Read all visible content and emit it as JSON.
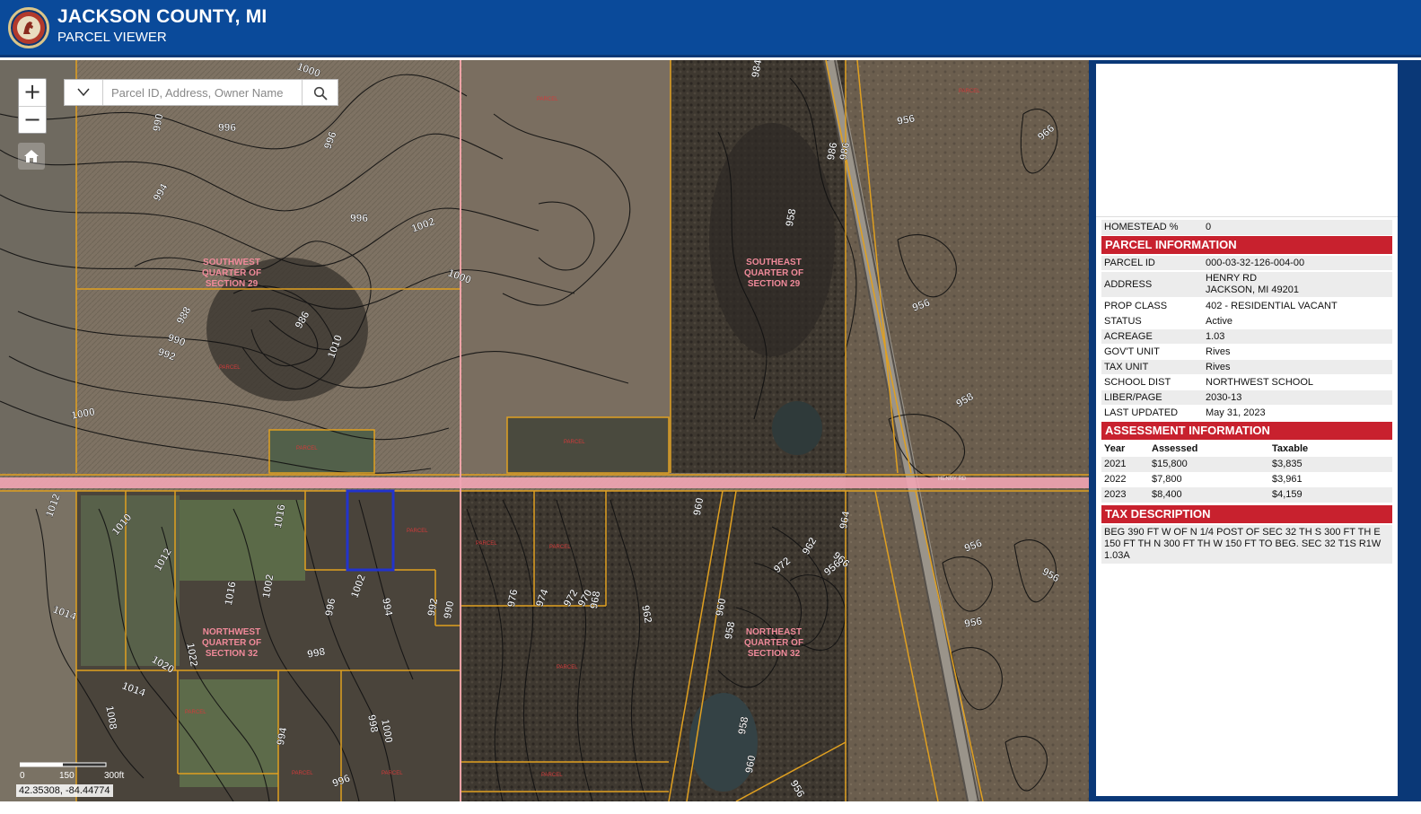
{
  "header": {
    "title": "JACKSON COUNTY, MI",
    "subtitle": "PARCEL VIEWER"
  },
  "map": {
    "search_placeholder": "Parcel ID, Address, Owner Name",
    "zoom_in": "+",
    "zoom_out": "−",
    "scale_labels": [
      "0",
      "150",
      "300ft"
    ],
    "coordinates": "42.35308, -84.44774",
    "road_label": "HENRY RD",
    "quarter_labels": [
      [
        "SOUTHWEST",
        "QUARTER OF",
        "SECTION 29"
      ],
      [
        "SOUTHEAST",
        "QUARTER OF",
        "SECTION 29"
      ],
      [
        "NORTHWEST",
        "QUARTER OF",
        "SECTION 32"
      ],
      [
        "NORTHEAST",
        "QUARTER OF",
        "SECTION 32"
      ]
    ],
    "contour_labels": [
      "1000",
      "990",
      "996",
      "994",
      "996",
      "1002",
      "1000",
      "988",
      "990",
      "992",
      "1010",
      "986",
      "1000",
      "996",
      "1012",
      "1010",
      "1016",
      "1016",
      "1012",
      "1014",
      "1022",
      "1020",
      "1014",
      "1008",
      "1002",
      "996",
      "1002",
      "994",
      "992",
      "990",
      "998",
      "998",
      "1000",
      "994",
      "996",
      "984",
      "976",
      "974",
      "972",
      "970",
      "968",
      "962",
      "960",
      "960",
      "962",
      "972",
      "966",
      "956",
      "956",
      "956",
      "956",
      "956",
      "956",
      "966",
      "958",
      "964",
      "986",
      "986",
      "958",
      "958",
      "960",
      "956",
      "958"
    ],
    "layers": {
      "selected_parcel_color": "#2233cc",
      "parcel_line_color": "#e0a020",
      "contour_color": "#111111",
      "road_color": "#f2a5b4"
    }
  },
  "panel": {
    "homestead": {
      "label": "HOMESTEAD %",
      "value": "0"
    },
    "parcel_info": {
      "title": "PARCEL INFORMATION",
      "rows": [
        {
          "label": "PARCEL ID",
          "value": "000-03-32-126-004-00"
        },
        {
          "label": "ADDRESS",
          "value": "HENRY RD",
          "value2": "JACKSON, MI 49201"
        },
        {
          "label": "PROP CLASS",
          "value": "402 - RESIDENTIAL VACANT"
        },
        {
          "label": "STATUS",
          "value": "Active"
        },
        {
          "label": "ACREAGE",
          "value": "1.03"
        },
        {
          "label": "GOV'T UNIT",
          "value": "Rives"
        },
        {
          "label": "TAX UNIT",
          "value": "Rives"
        },
        {
          "label": "SCHOOL DIST",
          "value": "NORTHWEST SCHOOL"
        },
        {
          "label": "LIBER/PAGE",
          "value": "2030-13"
        },
        {
          "label": "LAST UPDATED",
          "value": "May 31, 2023"
        }
      ]
    },
    "assessment": {
      "title": "ASSESSMENT INFORMATION",
      "columns": [
        "Year",
        "Assessed",
        "Taxable"
      ],
      "rows": [
        [
          "2021",
          "$15,800",
          "$3,835"
        ],
        [
          "2022",
          "$7,800",
          "$3,961"
        ],
        [
          "2023",
          "$8,400",
          "$4,159"
        ]
      ]
    },
    "tax_description": {
      "title": "TAX DESCRIPTION",
      "text": "BEG 390 FT W OF N 1/4 POST OF SEC 32 TH S 300 FT TH E 150 FT TH N 300 FT TH W 150 FT TO BEG. SEC 32 T1S R1W 1.03A"
    }
  }
}
